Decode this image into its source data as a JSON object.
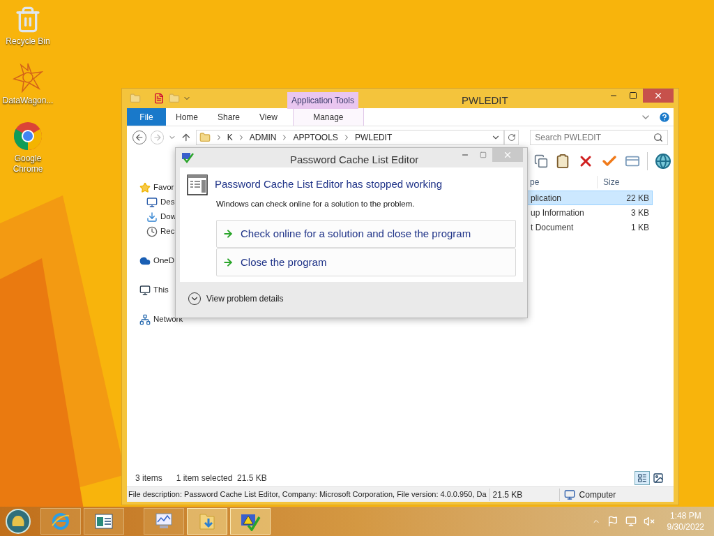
{
  "desktop_icons": [
    {
      "label": "Recycle Bin",
      "kind": "recycle"
    },
    {
      "label": "DataWagon...",
      "kind": "star"
    },
    {
      "label": "Google Chrome",
      "kind": "chrome"
    }
  ],
  "explorer": {
    "title": "PWLEDIT",
    "context_group": "Application Tools",
    "ribbon_tabs": [
      {
        "label": "File",
        "kind": "file",
        "selected": false
      },
      {
        "label": "Home",
        "kind": "tab",
        "selected": false
      },
      {
        "label": "Share",
        "kind": "tab",
        "selected": false
      },
      {
        "label": "View",
        "kind": "tab",
        "selected": false
      },
      {
        "label": "Manage",
        "kind": "context",
        "selected": false
      }
    ],
    "path": [
      "K",
      "ADMIN",
      "APPTOOLS",
      "PWLEDIT"
    ],
    "search": {
      "placeholder": "Search PWLEDIT"
    },
    "nav_items": [
      {
        "label": "Favor",
        "kind": "star",
        "children": [
          {
            "label": "Des",
            "kind": "desktop"
          },
          {
            "label": "Dow",
            "kind": "downloads"
          },
          {
            "label": "Rec",
            "kind": "recent"
          }
        ]
      },
      {
        "label": "OneD",
        "kind": "cloud"
      },
      {
        "label": "This",
        "kind": "pc"
      },
      {
        "label": "Network",
        "kind": "network"
      }
    ],
    "columns": [
      "pe",
      "Size"
    ],
    "rows": [
      {
        "type": "plication",
        "size": "22 KB",
        "selected": true
      },
      {
        "type": "up Information",
        "size": "3 KB",
        "selected": false
      },
      {
        "type": "t Document",
        "size": "1 KB",
        "selected": false
      }
    ],
    "status": {
      "count": "3 items",
      "selection": "1 item selected  21.5 KB"
    },
    "details_bar": {
      "description": "File description: Password Cache List Editor, Company: Microsoft Corporation, File version: 4.0.0.950, Da",
      "size": "21.5 KB",
      "zone": "Computer"
    }
  },
  "dialog": {
    "title": "Password Cache List Editor",
    "heading": "Password Cache List Editor has stopped working",
    "message": "Windows can check online for a solution to the problem.",
    "options": [
      "Check online for a solution and close the program",
      "Close the program"
    ],
    "details": "View problem details"
  },
  "taskbar": {
    "apps": [
      {
        "kind": "ie",
        "active": false
      },
      {
        "kind": "window",
        "active": false
      },
      {
        "kind": "chart",
        "active": false
      },
      {
        "kind": "folder",
        "active": true
      },
      {
        "kind": "warning",
        "active": true
      }
    ],
    "time": "1:48 PM",
    "date": "9/30/2022"
  }
}
